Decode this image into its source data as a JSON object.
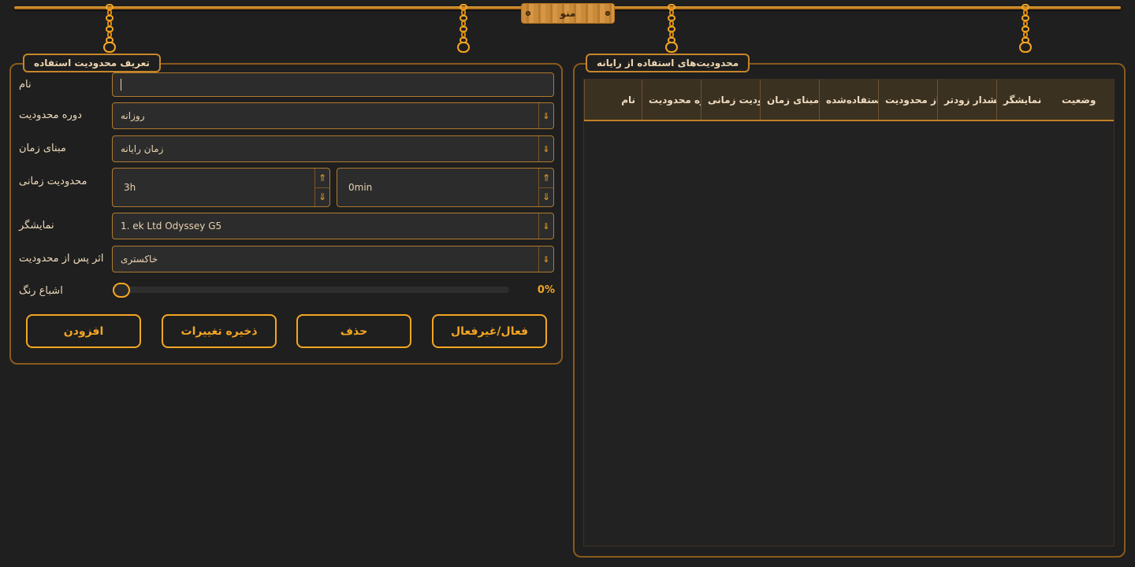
{
  "menu": {
    "label": "منو"
  },
  "rules_panel": {
    "title": "محدودیت‌های استفاده از رایانه",
    "columns": [
      "وضعیت",
      "نمایشگر",
      "هشدار زودتر",
      "از محدودیت",
      "استفاده‌شده",
      "مبنای زمان",
      "ودیت زمانی",
      "ره محدودیت",
      "نام"
    ]
  },
  "define_panel": {
    "title": "تعریف محدودیت استفاده",
    "name_label": "نام",
    "name_value": "",
    "period_label": "دوره محدودیت",
    "period_value": "روزانه",
    "basis_label": "مبنای زمان",
    "basis_value": "زمان رایانه",
    "limit_label": "محدودیت زمانی",
    "hours_value": "3h",
    "minutes_value": "0min",
    "display_label": "نمایشگر",
    "display_value": "1. ek Ltd Odyssey G5",
    "effect_label": "اثر پس از محدودیت",
    "effect_value": "خاکستری",
    "saturation_label": "اشباع رنگ",
    "saturation_value": "0%",
    "saturation_fraction": 0.0
  },
  "buttons": {
    "toggle": "فعال/غیرفعال",
    "delete": "حذف",
    "save": "ذخیره تغییرات",
    "add": "افزودن"
  },
  "colors": {
    "accent": "#f5a623",
    "background": "#1f1f1f",
    "field": "#2c2c2c"
  },
  "icons": {
    "dropdown": "down-arrow-icon",
    "spin_up": "up-arrow-icon",
    "spin_down": "down-arrow-icon"
  }
}
